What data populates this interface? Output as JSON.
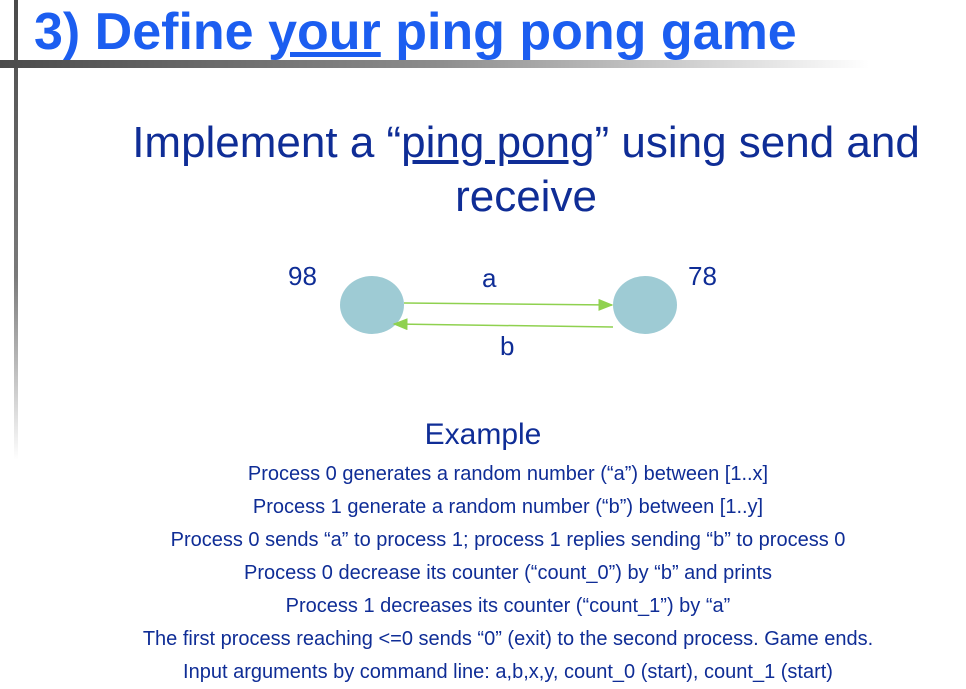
{
  "title": {
    "part1": "3) Define ",
    "part2_underlined": "your",
    "part3": " ping pong game"
  },
  "subtitle": {
    "part1": "Implement a “",
    "part2_underlined": "ping pong",
    "part3": "” using send and receive"
  },
  "diagram": {
    "left_value": "98",
    "right_value": "78",
    "top_edge_label": "a",
    "bottom_edge_label": "b",
    "node_color": "#9ecbd4",
    "arrow_color": "#8fd14f"
  },
  "example": {
    "heading": "Example",
    "lines": [
      "Process 0 generates a random number (“a”) between [1..x]",
      "Process 1 generate a random number (“b”) between [1..y]",
      "Process 0 sends “a” to process 1; process 1 replies sending “b” to process 0",
      "Process 0 decrease its counter (“count_0”) by “b” and prints",
      "Process 1 decreases its counter (“count_1”) by “a”",
      "The first process reaching <=0 sends “0” (exit) to the second process. Game ends.",
      "Input arguments by command line: a,b,x,y, count_0 (start), count_1 (start)"
    ]
  },
  "colors": {
    "title": "#1c5ef0",
    "body_text": "#0f2d96"
  }
}
